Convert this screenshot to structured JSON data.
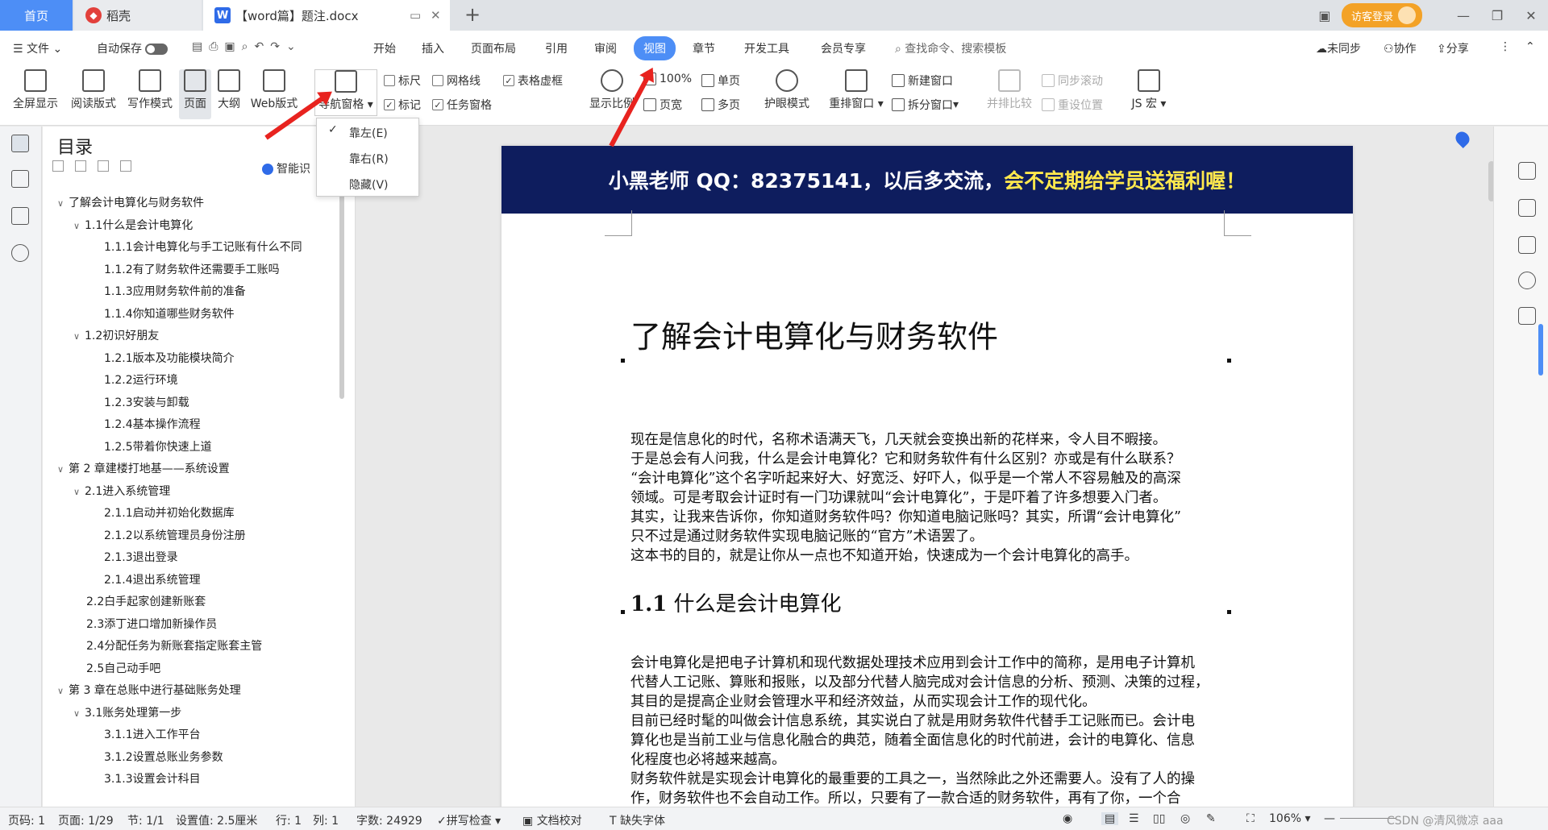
{
  "tabs": {
    "home": "首页",
    "daoke": "稻壳",
    "doc": "【word篇】题注.docx"
  },
  "topbar": {
    "visitor_login": "访客登录"
  },
  "menubar": {
    "file": "文件",
    "autosave": "自动保存",
    "items": [
      "开始",
      "插入",
      "页面布局",
      "引用",
      "审阅",
      "视图",
      "章节",
      "开发工具",
      "会员专享"
    ],
    "search_placeholder": "查找命令、搜索模板",
    "sync": "未同步",
    "collab": "协作",
    "share": "分享"
  },
  "ribbon": {
    "fullscreen": "全屏显示",
    "reading": "阅读版式",
    "writing": "写作模式",
    "page": "页面",
    "outline": "大纲",
    "web": "Web版式",
    "nav_pane": "导航窗格",
    "ruler": "标尺",
    "gridlines": "网格线",
    "table_gridlines": "表格虚框",
    "markup": "标记",
    "task_pane": "任务窗格",
    "zoom_label": "显示比例",
    "zoom_100": "100%",
    "page_width": "页宽",
    "single_page": "单页",
    "multi_page": "多页",
    "eye_mode": "护眼模式",
    "arrange": "重排窗口",
    "new_window": "新建窗口",
    "split_window": "拆分窗口",
    "side_by_side": "并排比较",
    "sync_scroll": "同步滚动",
    "reset_pos": "重设位置",
    "js_macro": "JS 宏"
  },
  "dropdown": {
    "left": "靠左(E)",
    "right": "靠右(R)",
    "hide": "隐藏(V)"
  },
  "nav": {
    "title": "目录",
    "smart": "智能识",
    "toc": [
      {
        "text": "了解会计电算化与财务软件",
        "level": 0,
        "caret": true
      },
      {
        "text": "1.1什么是会计电算化",
        "level": 1,
        "caret": true
      },
      {
        "text": "1.1.1会计电算化与手工记账有什么不同",
        "level": 2
      },
      {
        "text": "1.1.2有了财务软件还需要手工账吗",
        "level": 2
      },
      {
        "text": "1.1.3应用财务软件前的准备",
        "level": 2
      },
      {
        "text": "1.1.4你知道哪些财务软件",
        "level": 2
      },
      {
        "text": "1.2初识好朋友",
        "level": 1,
        "caret": true
      },
      {
        "text": "1.2.1版本及功能模块简介",
        "level": 2
      },
      {
        "text": "1.2.2运行环境",
        "level": 2
      },
      {
        "text": "1.2.3安装与卸载",
        "level": 2
      },
      {
        "text": "1.2.4基本操作流程",
        "level": 2
      },
      {
        "text": "1.2.5带着你快速上道",
        "level": 2
      },
      {
        "text": "第 2 章建楼打地基——系统设置",
        "level": 0,
        "caret": true
      },
      {
        "text": "2.1进入系统管理",
        "level": 1,
        "caret": true
      },
      {
        "text": "2.1.1启动并初始化数据库",
        "level": 2
      },
      {
        "text": "2.1.2以系统管理员身份注册",
        "level": 2
      },
      {
        "text": "2.1.3退出登录",
        "level": 2
      },
      {
        "text": "2.1.4退出系统管理",
        "level": 2
      },
      {
        "text": "2.2白手起家创建新账套",
        "level": 1
      },
      {
        "text": "2.3添丁进口增加新操作员",
        "level": 1
      },
      {
        "text": "2.4分配任务为新账套指定账套主管",
        "level": 1
      },
      {
        "text": "2.5自己动手吧",
        "level": 1
      },
      {
        "text": "第 3 章在总账中进行基础账务处理",
        "level": 0,
        "caret": true
      },
      {
        "text": "3.1账务处理第一步",
        "level": 1,
        "caret": true
      },
      {
        "text": "3.1.1进入工作平台",
        "level": 2
      },
      {
        "text": "3.1.2设置总账业务参数",
        "level": 2
      },
      {
        "text": "3.1.3设置会计科目",
        "level": 2
      }
    ]
  },
  "document": {
    "banner_main": "小黑老师 QQ：82375141，以后多交流，",
    "banner_highlight": "会不定期给学员送福利喔！",
    "heading1": "了解会计电算化与财务软件",
    "intro": [
      "现在是信息化的时代，名称术语满天飞，几天就会变换出新的花样来，令人目不暇接。",
      "于是总会有人问我，什么是会计电算化？它和财务软件有什么区别？亦或是有什么联系？",
      "“会计电算化”这个名字听起来好大、好宽泛、好吓人，似乎是一个常人不容易触及的高深",
      "领域。可是考取会计证时有一门功课就叫“会计电算化”，于是吓着了许多想要入门者。",
      "其实，让我来告诉你，你知道财务软件吗？你知道电脑记账吗？其实，所谓“会计电算化”",
      "只不过是通过财务软件实现电脑记账的“官方”术语罢了。",
      "这本书的目的，就是让你从一点也不知道开始，快速成为一个会计电算化的高手。"
    ],
    "heading2_num": "1.1",
    "heading2_text": "什么是会计电算化",
    "body": [
      "会计电算化是把电子计算机和现代数据处理技术应用到会计工作中的简称，是用电子计算机",
      "代替人工记账、算账和报账，以及部分代替人脑完成对会计信息的分析、预测、决策的过程，",
      "其目的是提高企业财会管理水平和经济效益，从而实现会计工作的现代化。",
      "目前已经时髦的叫做会计信息系统，其实说白了就是用财务软件代替手工记账而已。会计电",
      "算化也是当前工业与信息化融合的典范，随着全面信息化的时代前进，会计的电算化、信息",
      "化程度也必将越来越高。",
      "财务软件就是实现会计电算化的最重要的工具之一，当然除此之外还需要人。没有了人的操",
      "作，财务软件也不会自动工作。所以，只要有了一款合适的财务软件，再有了你，一个合"
    ]
  },
  "status": {
    "page_num": "页码: 1",
    "pages": "页面: 1/29",
    "section": "节: 1/1",
    "setting": "设置值: 2.5厘米",
    "row": "行: 1",
    "col": "列: 1",
    "words": "字数: 24929",
    "spell": "拼写检查",
    "proof": "文档校对",
    "missing_font": "缺失字体",
    "zoom": "106%",
    "watermark": "CSDN @清风微凉 aaa"
  },
  "colors": {
    "accent": "#4d8ef6",
    "banner_bg": "#0e1d5e",
    "banner_highlight": "#ffe84d",
    "arrow": "#e8231f"
  }
}
